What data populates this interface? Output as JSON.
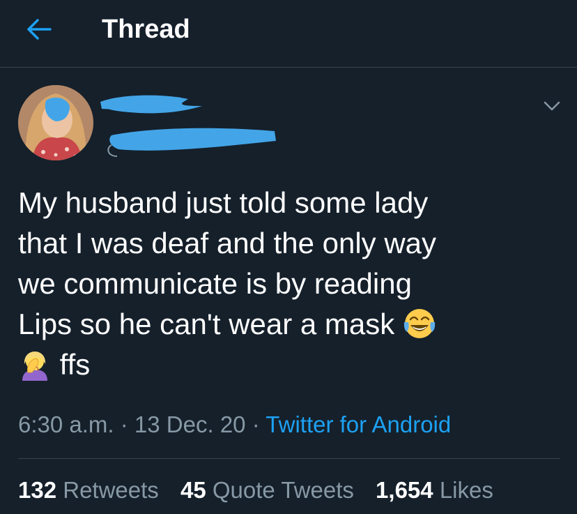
{
  "header": {
    "title": "Thread",
    "back_icon": "arrow-left-icon",
    "accent": "#1da1f2"
  },
  "tweet": {
    "text_line1": "My husband just told some lady",
    "text_line2": "that I was deaf and the only way",
    "text_line3": "we communicate is by reading",
    "text_line4": "Lips so he can't wear a mask",
    "text_line5": "ffs",
    "emoji_1": "face-with-tears-of-joy",
    "emoji_2": "woman-facepalming",
    "time": "6:30 a.m.",
    "separator": "·",
    "date": "13 Dec. 20",
    "source": "Twitter for Android"
  },
  "stats": {
    "retweets_count": "132",
    "retweets_label": "Retweets",
    "quote_count": "45",
    "quote_label": "Quote Tweets",
    "likes_count": "1,654",
    "likes_label": "Likes"
  },
  "colors": {
    "background": "#15202b",
    "secondary_text": "#8899a6",
    "divider": "#38444d",
    "redaction": "#43a5e8"
  }
}
